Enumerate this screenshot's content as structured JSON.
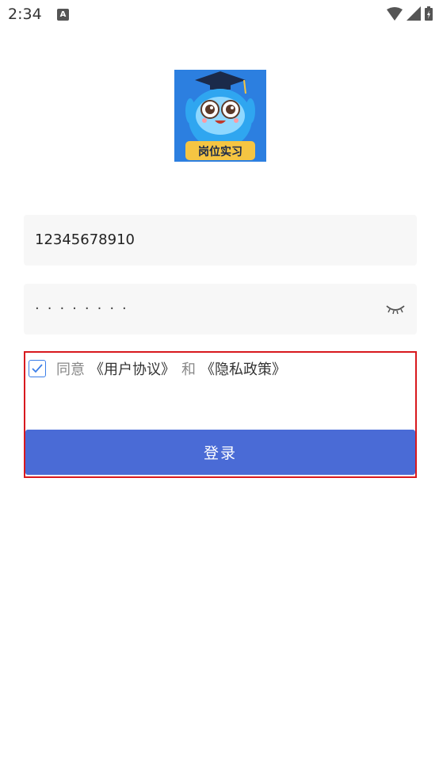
{
  "status_bar": {
    "time": "2:34",
    "notification_icon": "text-a-icon",
    "icons": [
      "wifi-icon",
      "signal-icon",
      "battery-charging-icon"
    ]
  },
  "logo": {
    "text": "岗位实习",
    "icon": "owl-graduate-logo"
  },
  "login_form": {
    "phone_value": "12345678910",
    "password_mask": "········",
    "password_toggle_icon": "eye-closed-icon"
  },
  "agreement": {
    "checked": true,
    "prefix": "同意",
    "user_agreement": "《用户协议》",
    "and": "和",
    "privacy_policy": "《隐私政策》"
  },
  "login_button": {
    "label": "登录"
  },
  "colors": {
    "primary": "#4a6bd6",
    "checkbox": "#3b7ee8",
    "highlight": "#d8191e",
    "field_bg": "#f7f7f7"
  }
}
